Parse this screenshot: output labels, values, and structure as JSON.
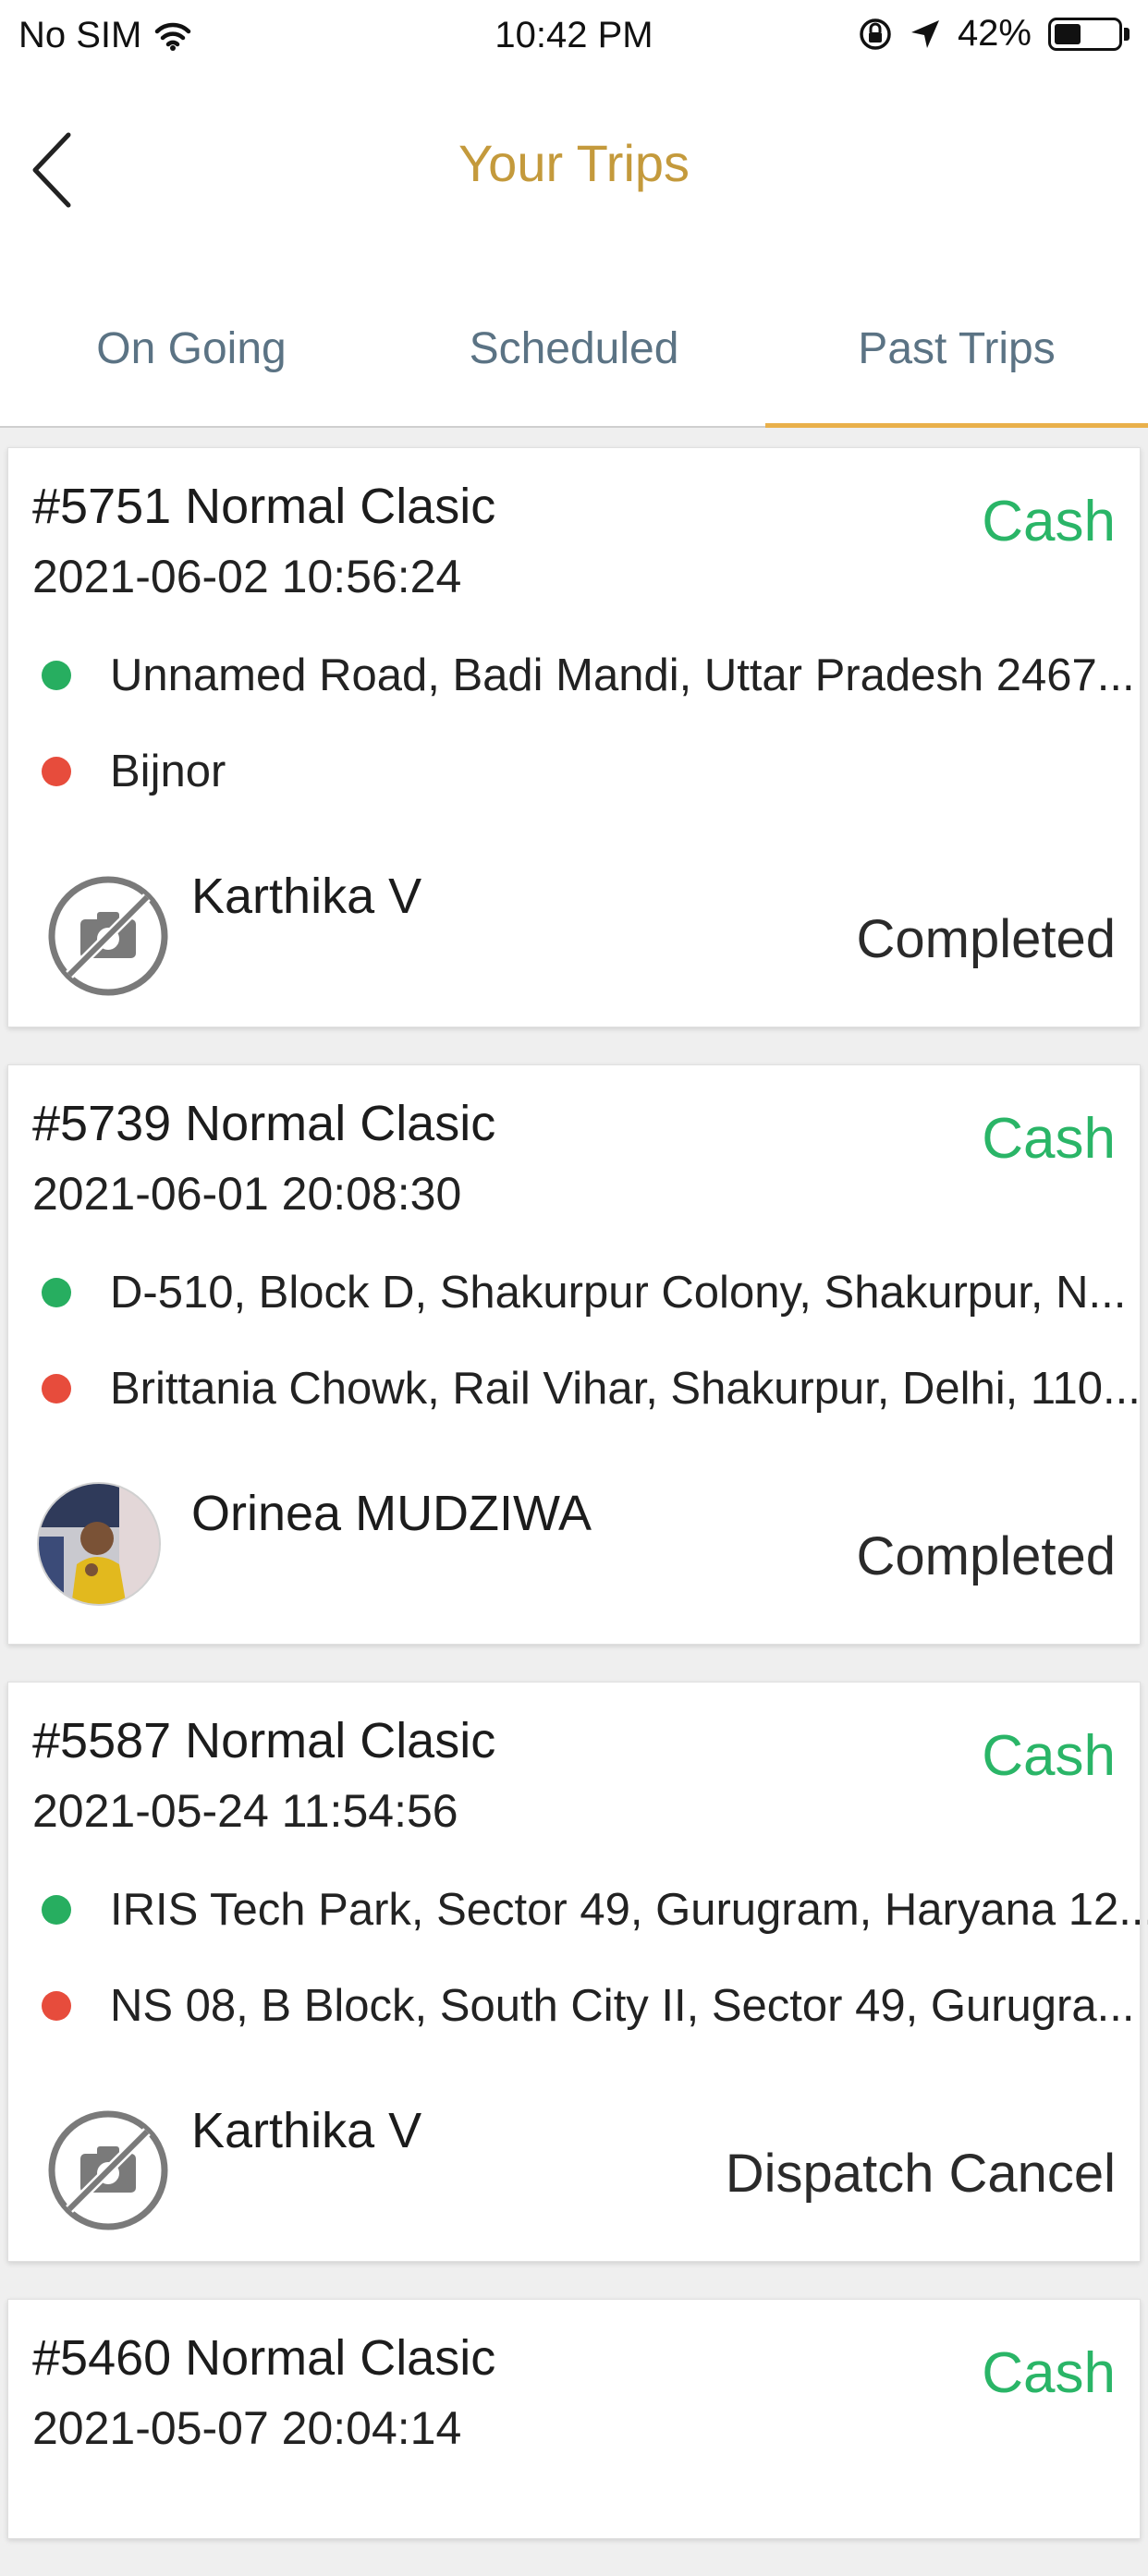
{
  "status_bar": {
    "carrier": "No SIM",
    "time": "10:42 PM",
    "battery": "42%",
    "battery_level": 0.42
  },
  "header": {
    "title": "Your Trips",
    "back_icon": "chevron-left-icon"
  },
  "tabs": [
    {
      "label": "On Going",
      "active": false
    },
    {
      "label": "Scheduled",
      "active": false
    },
    {
      "label": "Past Trips",
      "active": true
    }
  ],
  "colors": {
    "accent": "#c49a3c",
    "tab_underline": "#e9b04b",
    "cash": "#2ab567",
    "pickup_dot": "#27ae60",
    "drop_dot": "#e74c3c",
    "tab_text": "#5b7384"
  },
  "trips": [
    {
      "title": "#5751 Normal Clasic",
      "datetime": "2021-06-02 10:56:24",
      "payment": "Cash",
      "pickup": "Unnamed Road, Badi Mandi, Uttar Pradesh 2467...",
      "drop": "Bijnor",
      "driver": "Karthika V",
      "avatar": "no-photo-icon",
      "status": "Completed"
    },
    {
      "title": "#5739 Normal Clasic",
      "datetime": "2021-06-01 20:08:30",
      "payment": "Cash",
      "pickup": "D-510, Block D, Shakurpur Colony, Shakurpur, N...",
      "drop": "Brittania Chowk, Rail Vihar, Shakurpur, Delhi, 110...",
      "driver": "Orinea MUDZIWA",
      "avatar": "driver-photo",
      "status": "Completed"
    },
    {
      "title": "#5587 Normal Clasic",
      "datetime": "2021-05-24 11:54:56",
      "payment": "Cash",
      "pickup": "IRIS Tech Park, Sector 49, Gurugram, Haryana 12...",
      "drop": "NS 08, B Block, South City II, Sector 49, Gurugra...",
      "driver": "Karthika V",
      "avatar": "no-photo-icon",
      "status": "Dispatch Cancel"
    },
    {
      "title": "#5460 Normal Clasic",
      "datetime": "2021-05-07 20:04:14",
      "payment": "Cash"
    }
  ]
}
